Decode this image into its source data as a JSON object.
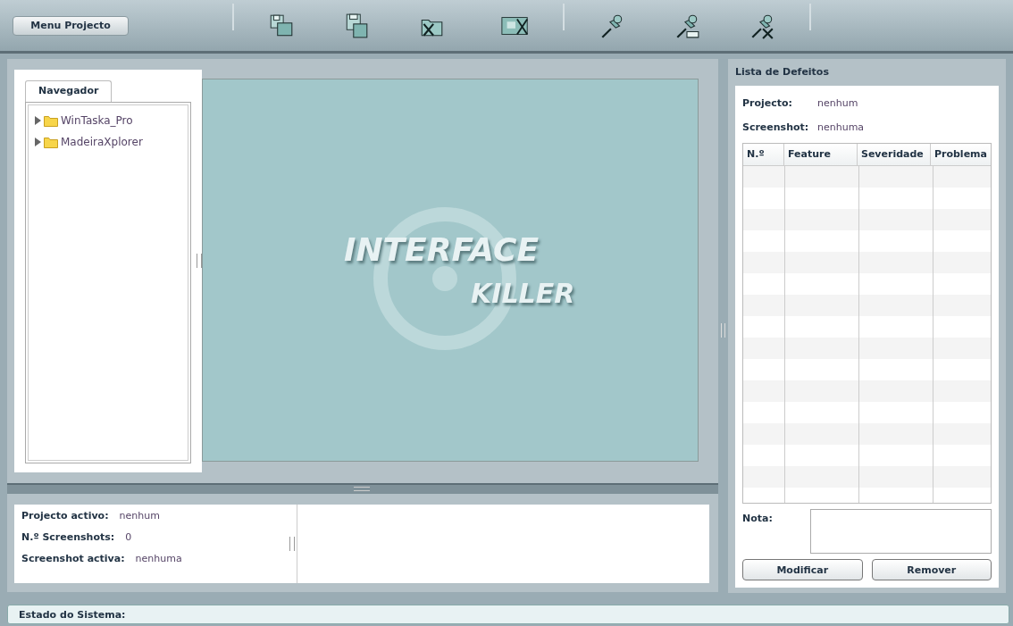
{
  "toolbar": {
    "menu_button": "Menu Projecto"
  },
  "navigator": {
    "tabs": [
      {
        "label": "Navegador",
        "selected": true
      }
    ],
    "tree": [
      {
        "label": "WinTaska_Pro",
        "expanded": false
      },
      {
        "label": "MadeiraXplorer",
        "expanded": false
      }
    ]
  },
  "viewer": {
    "logo": [
      "INTERFACE",
      "KILLER"
    ]
  },
  "info": [
    {
      "label": "Projecto activo:",
      "value": "nenhum"
    },
    {
      "label": "N.º Screenshots:",
      "value": "0"
    },
    {
      "label": "Screenshot activa:",
      "value": "nenhuma"
    }
  ],
  "defects": {
    "title": "Lista de Defeitos",
    "fields": [
      {
        "label": "Projecto:",
        "value": "nenhum"
      },
      {
        "label": "Screenshot:",
        "value": "nenhuma"
      }
    ],
    "columns": [
      "N.º",
      "Feature",
      "Severidade",
      "Problema"
    ],
    "note_label": "Nota:",
    "buttons": [
      "Modificar",
      "Remover"
    ]
  },
  "status_bar": {
    "label": "Estado do Sistema:"
  }
}
